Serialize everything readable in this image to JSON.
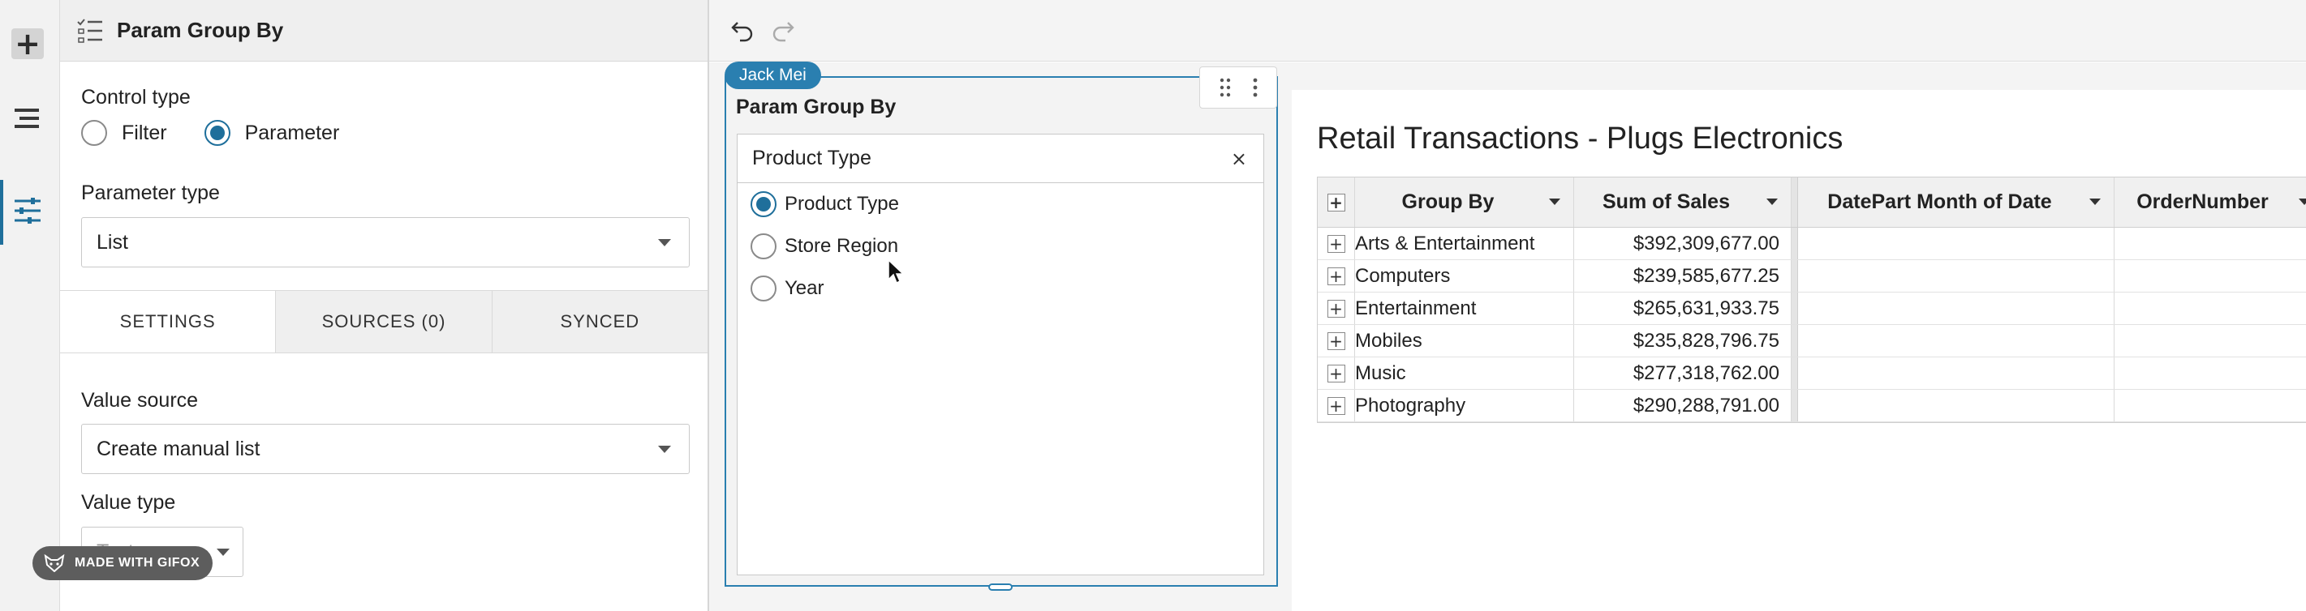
{
  "rail": {
    "items": [
      {
        "icon": "plus-icon"
      },
      {
        "icon": "layers-icon"
      },
      {
        "icon": "sliders-icon",
        "active": true
      }
    ]
  },
  "panel": {
    "title": "Param Group By",
    "control_type": {
      "label": "Control type",
      "options": [
        {
          "label": "Filter",
          "selected": false
        },
        {
          "label": "Parameter",
          "selected": true
        }
      ]
    },
    "parameter_type": {
      "label": "Parameter type",
      "value": "List"
    },
    "tabs": [
      {
        "label": "SETTINGS",
        "active": true
      },
      {
        "label": "SOURCES (0)",
        "active": false
      },
      {
        "label": "SYNCED",
        "active": false
      }
    ],
    "value_source": {
      "label": "Value source",
      "value": "Create manual list"
    },
    "value_type": {
      "label": "Value type",
      "value": "Text"
    }
  },
  "watermark": {
    "text": "MADE WITH GIFOX"
  },
  "toolbar": {
    "undo_icon": "undo-icon",
    "redo_icon": "redo-icon"
  },
  "control_card": {
    "user_tag": "Jack Mei",
    "title": "Param Group By",
    "selected_value": "Product Type",
    "options": [
      {
        "label": "Product Type",
        "selected": true
      },
      {
        "label": "Store Region",
        "selected": false
      },
      {
        "label": "Year",
        "selected": false
      }
    ]
  },
  "table": {
    "title": "Retail Transactions - Plugs Electronics",
    "columns": [
      "Group By",
      "Sum of Sales",
      "DatePart Month of Date",
      "OrderNumber"
    ],
    "rows": [
      {
        "group": "Arts & Entertainment",
        "sales": "$392,309,677.00"
      },
      {
        "group": "Computers",
        "sales": "$239,585,677.25"
      },
      {
        "group": "Entertainment",
        "sales": "$265,631,933.75"
      },
      {
        "group": "Mobiles",
        "sales": "$235,828,796.75"
      },
      {
        "group": "Music",
        "sales": "$277,318,762.00"
      },
      {
        "group": "Photography",
        "sales": "$290,288,791.00"
      }
    ]
  },
  "colors": {
    "accent": "#2a7fb0",
    "active_rail": "#1f6f9b"
  }
}
